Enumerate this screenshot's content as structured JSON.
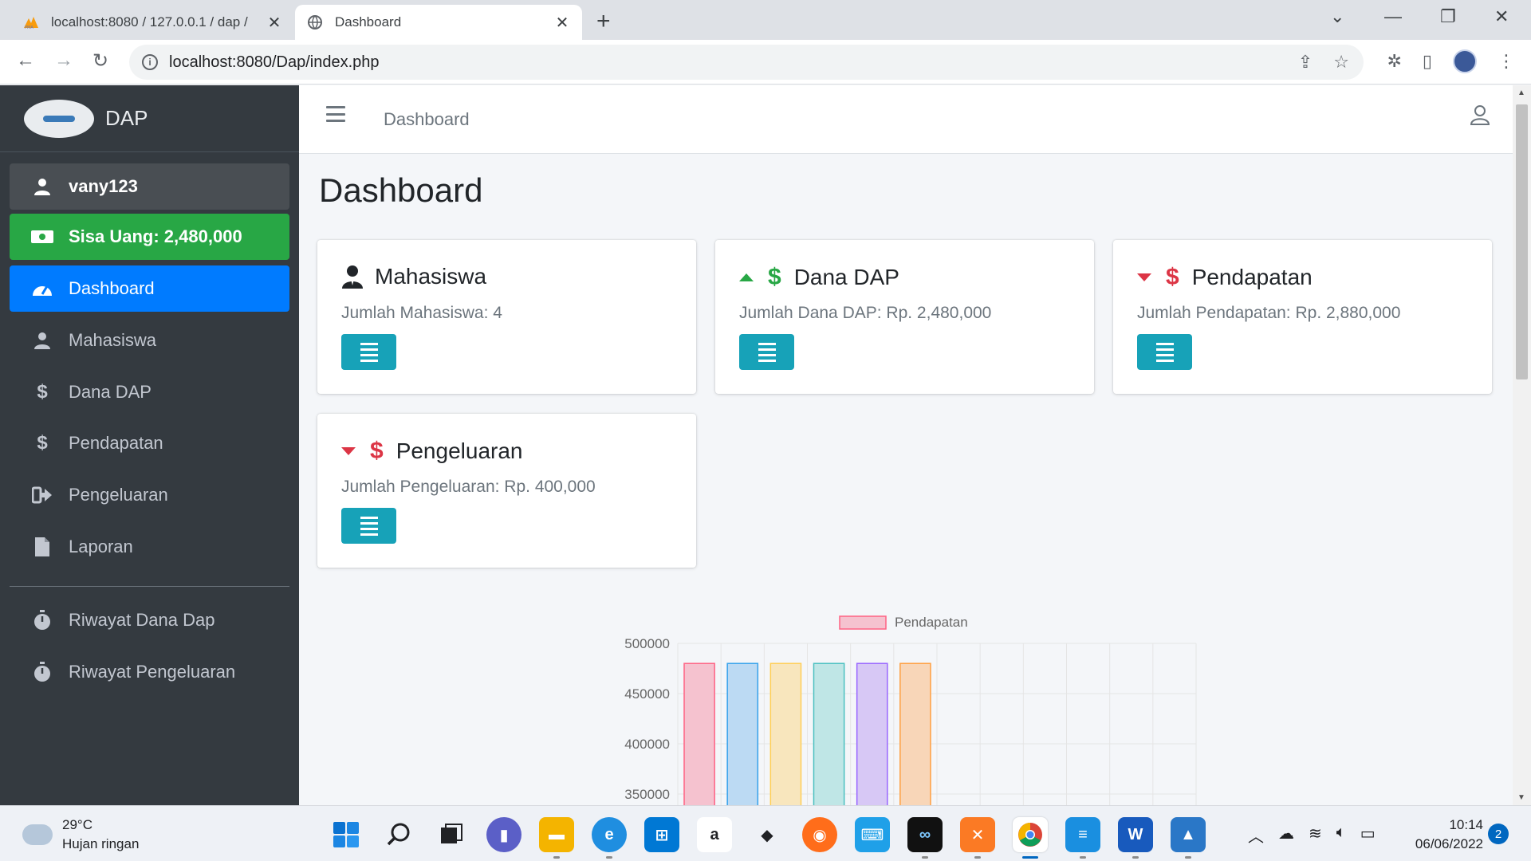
{
  "browser": {
    "tabs": [
      {
        "title": "localhost:8080 / 127.0.0.1 / dap /",
        "active": false
      },
      {
        "title": "Dashboard",
        "active": true
      }
    ],
    "url": "localhost:8080/Dap/index.php"
  },
  "sidebar": {
    "brand": "DAP",
    "user": "vany123",
    "balance": "Sisa Uang: 2,480,000",
    "items": [
      {
        "label": "Dashboard",
        "icon": "tachometer-icon",
        "active": true
      },
      {
        "label": "Mahasiswa",
        "icon": "user-icon"
      },
      {
        "label": "Dana DAP",
        "icon": "dollar-icon"
      },
      {
        "label": "Pendapatan",
        "icon": "dollar-icon"
      },
      {
        "label": "Pengeluaran",
        "icon": "sign-out-icon"
      },
      {
        "label": "Laporan",
        "icon": "file-icon"
      }
    ],
    "history": [
      {
        "label": "Riwayat Dana Dap",
        "icon": "stopwatch-icon"
      },
      {
        "label": "Riwayat Pengeluaran",
        "icon": "stopwatch-icon"
      }
    ]
  },
  "topnav": {
    "breadcrumb": "Dashboard"
  },
  "page_title": "Dashboard",
  "cards": [
    {
      "title": "Mahasiswa",
      "text": "Jumlah Mahasiswa: 4",
      "icon": "user-tie-icon"
    },
    {
      "title": "Dana DAP",
      "text": "Jumlah Dana DAP: Rp. 2,480,000",
      "icon": "dollar-icon",
      "trend": "up",
      "color": "#28a745"
    },
    {
      "title": "Pendapatan",
      "text": "Jumlah Pendapatan: Rp. 2,880,000",
      "icon": "dollar-icon",
      "trend": "down",
      "color": "#dc3545"
    },
    {
      "title": "Pengeluaran",
      "text": "Jumlah Pengeluaran: Rp. 400,000",
      "icon": "dollar-icon",
      "trend": "down",
      "color": "#dc3545"
    }
  ],
  "chart_data": {
    "type": "bar",
    "legend": "Pendapatan",
    "legend_position": "top",
    "y_ticks": [
      "500000",
      "450000",
      "400000",
      "350000"
    ],
    "ylim_visible": [
      350000,
      500000
    ],
    "categories_count": 12,
    "series": [
      {
        "name": "Pendapatan",
        "values": [
          480000,
          480000,
          480000,
          480000,
          480000,
          480000
        ]
      }
    ],
    "bar_colors": [
      "#f5c2cf",
      "#bcdaf3",
      "#f8e6bd",
      "#bfe6e6",
      "#d7c8f5",
      "#f8d6b8"
    ],
    "bar_borders": [
      "#ff6384",
      "#36a2eb",
      "#ffce56",
      "#4bc0c0",
      "#9966ff",
      "#ff9f40"
    ],
    "grid": true
  },
  "taskbar": {
    "weather_temp": "29°C",
    "weather_desc": "Hujan ringan",
    "time": "10:14",
    "date": "06/06/2022",
    "notifications": "2"
  }
}
